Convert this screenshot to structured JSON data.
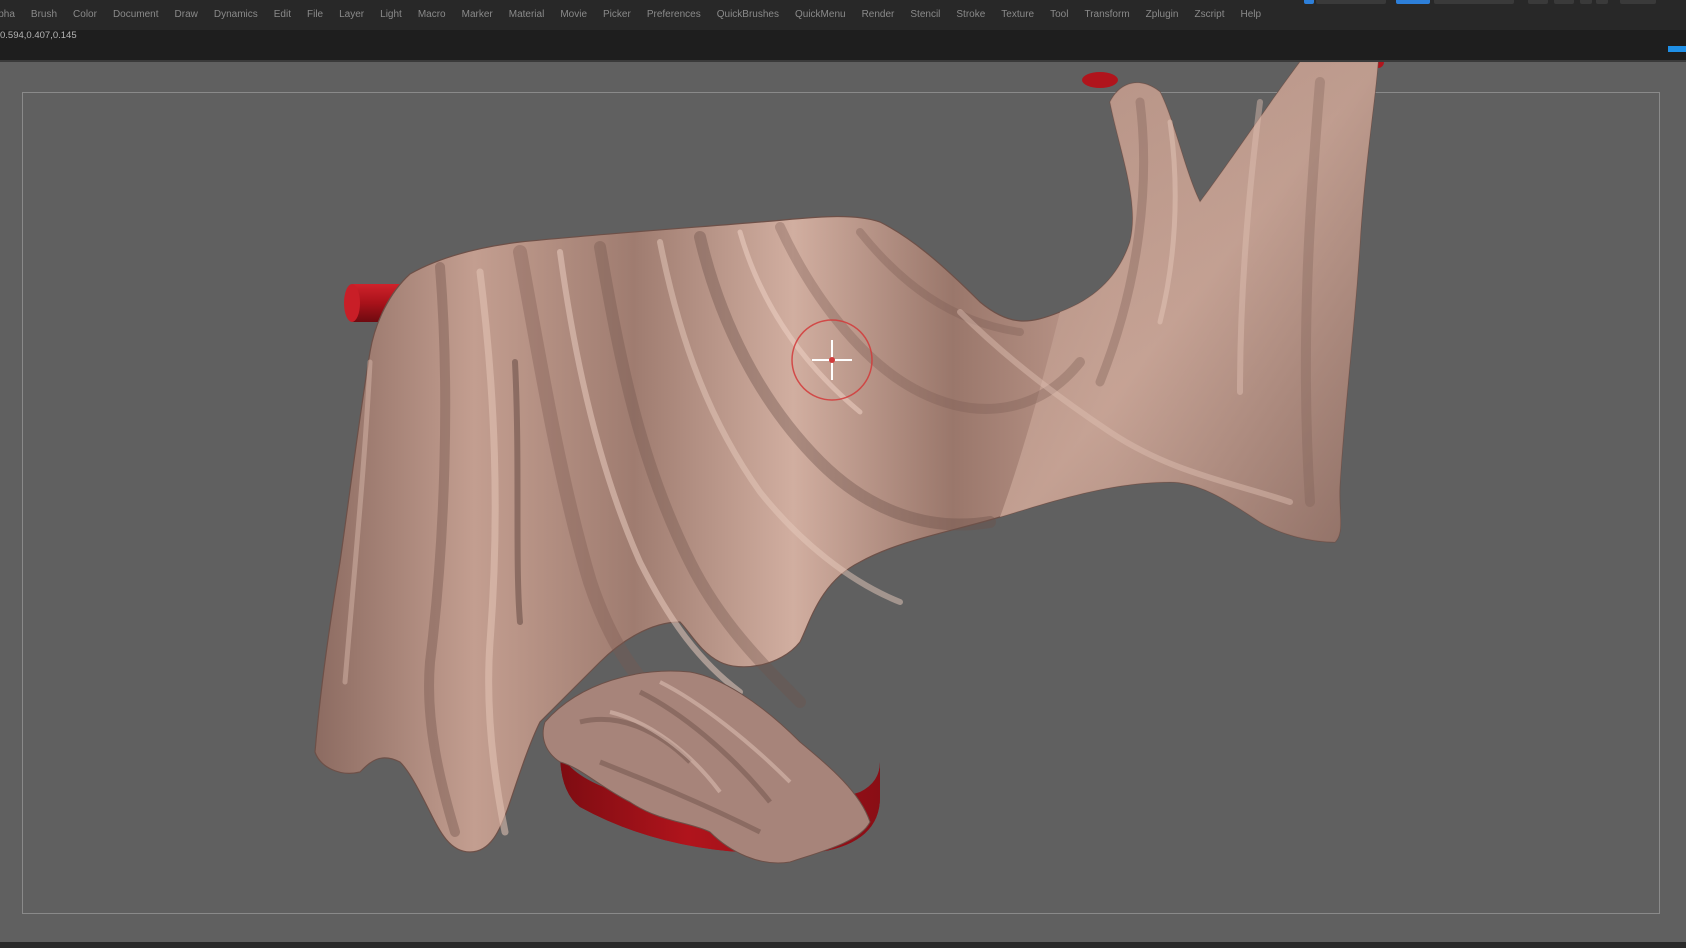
{
  "menubar": {
    "items": [
      "lpha",
      "Brush",
      "Color",
      "Document",
      "Draw",
      "Dynamics",
      "Edit",
      "File",
      "Layer",
      "Light",
      "Macro",
      "Marker",
      "Material",
      "Movie",
      "Picker",
      "Preferences",
      "QuickBrushes",
      "QuickMenu",
      "Render",
      "Stencil",
      "Stroke",
      "Texture",
      "Tool",
      "Transform",
      "Zplugin",
      "Zscript",
      "Help"
    ]
  },
  "status": {
    "readout": "0.594,0.407,0.145"
  },
  "colors": {
    "canvas_bg": "#606060",
    "cloth": "#a98578",
    "rod_red": "#b0141c",
    "cursor_ring": "#d23a3a",
    "accent_blue": "#1f8fe6"
  },
  "icons": {
    "brush_cursor": "crosshair-brush-icon"
  }
}
